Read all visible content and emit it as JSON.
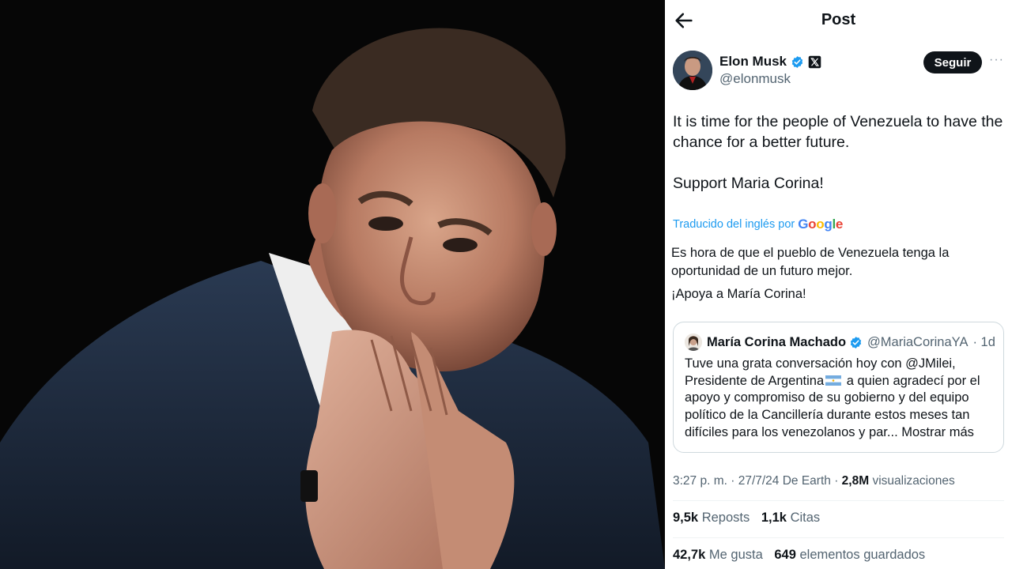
{
  "header": {
    "title": "Post"
  },
  "author": {
    "name": "Elon Musk",
    "handle": "@elonmusk",
    "follow_label": "Seguir",
    "more_label": "···"
  },
  "tweet": {
    "line1": "It is time for the people of Venezuela to have the chance for a better future.",
    "line2": "Support Maria Corina!"
  },
  "translation": {
    "label": "Traducido del inglés por",
    "provider": "Google",
    "text1": "Es hora de que el pueblo de Venezuela tenga la oportunidad de un futuro mejor.",
    "text2": "¡Apoya a María Corina!"
  },
  "quote": {
    "name": "María Corina Machado",
    "handle": "@MariaCorinaYA",
    "time": "· 1d",
    "text_before_flag": "Tuve una grata conversación hoy con @JMilei, Presidente de Argentina",
    "text_after_flag": " a quien agradecí por el apoyo y compromiso de su gobierno y del equipo político de la Cancillería durante estos meses tan difíciles para los venezolanos y par...",
    "show_more": "Mostrar más"
  },
  "meta": {
    "time": "3:27 p. m. · 27/7/24 De Earth · ",
    "views_count": "2,8M",
    "views_label": " visualizaciones"
  },
  "stats": {
    "reposts_count": "9,5k",
    "reposts_label": "Reposts",
    "quotes_count": "1,1k",
    "quotes_label": "Citas",
    "likes_count": "42,7k",
    "likes_label": "Me gusta",
    "saves_count": "649",
    "saves_label": "elementos guardados"
  },
  "colors": {
    "accent": "#1d9bf0",
    "text": "#0f1419",
    "muted": "#536471",
    "verified": "#1d9bf0"
  },
  "icons": {
    "back": "arrow-left-icon",
    "verified": "verified-badge-icon",
    "x_logo": "x-logo-icon",
    "flag": "argentina-flag-icon"
  }
}
